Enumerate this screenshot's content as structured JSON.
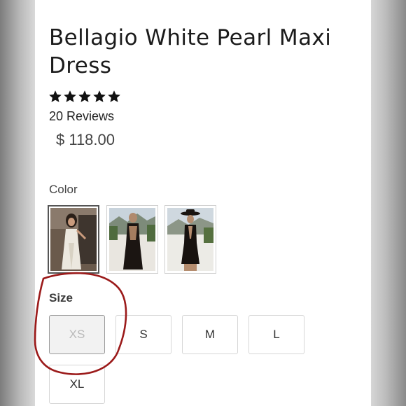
{
  "product": {
    "title": "Bellagio White Pearl Maxi Dress",
    "rating": 5,
    "reviews_label": "20 Reviews",
    "price": "$ 118.00"
  },
  "color": {
    "label": "Color",
    "swatches": [
      {
        "name": "white",
        "selected": true
      },
      {
        "name": "black-lace",
        "selected": false
      },
      {
        "name": "black-halter",
        "selected": false
      }
    ]
  },
  "size": {
    "label": "Size",
    "options": [
      {
        "label": "XS",
        "available": false
      },
      {
        "label": "S",
        "available": true
      },
      {
        "label": "M",
        "available": true
      },
      {
        "label": "L",
        "available": true
      },
      {
        "label": "XL",
        "available": true
      }
    ]
  },
  "colors": {
    "text": "#1b1b1b",
    "annotation": "#9b1a1a"
  }
}
